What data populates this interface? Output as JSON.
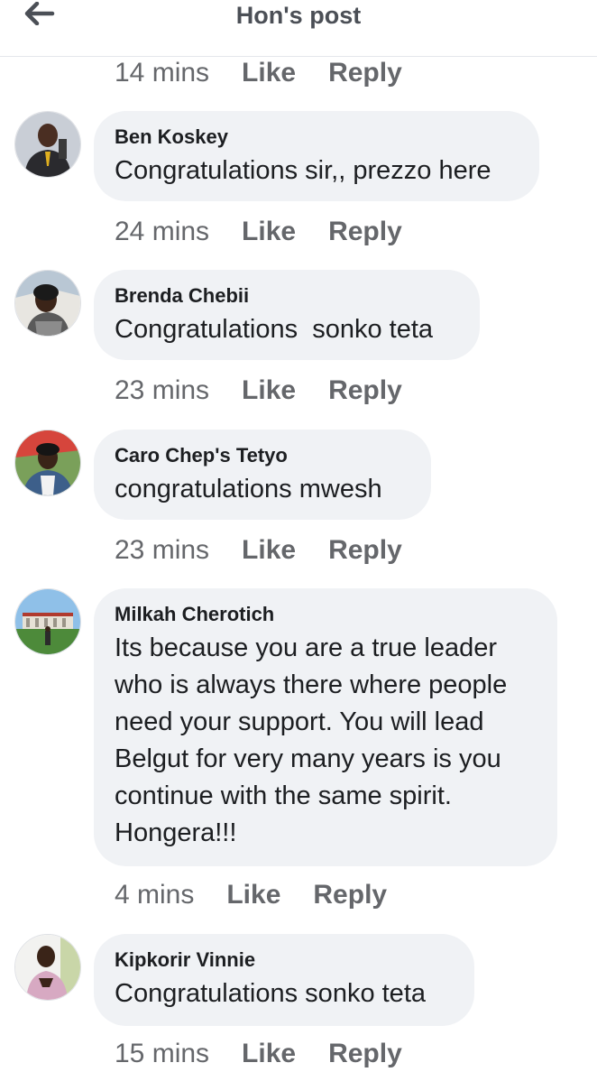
{
  "header": {
    "title": "Hon's post",
    "back_icon": "arrow-left-icon"
  },
  "top_meta": {
    "time": "14 mins",
    "like_label": "Like",
    "reply_label": "Reply"
  },
  "comments": [
    {
      "author": "Ben Koskey",
      "text": "Congratulations sir,, prezzo here",
      "time": "24 mins",
      "like_label": "Like",
      "reply_label": "Reply"
    },
    {
      "author": "Brenda Chebii",
      "text": "Congratulations  sonko teta",
      "time": "23 mins",
      "like_label": "Like",
      "reply_label": "Reply"
    },
    {
      "author": "Caro Chep's Tetyo",
      "text": "congratulations mwesh",
      "time": "23 mins",
      "like_label": "Like",
      "reply_label": "Reply"
    },
    {
      "author": "Milkah Cherotich",
      "text": "Its because you are a true leader\nwho is always there where people\nneed your support. You will lead\nBelgut for very many years is you\ncontinue with the same spirit.\nHongera!!!",
      "time": "4 mins",
      "like_label": "Like",
      "reply_label": "Reply"
    },
    {
      "author": "Kipkorir Vinnie",
      "text": "Congratulations sonko teta",
      "time": "15 mins",
      "like_label": "Like",
      "reply_label": "Reply"
    }
  ],
  "colors": {
    "bubble": "#f0f2f5",
    "meta_text": "#65676b",
    "title_text": "#4b4f56"
  }
}
